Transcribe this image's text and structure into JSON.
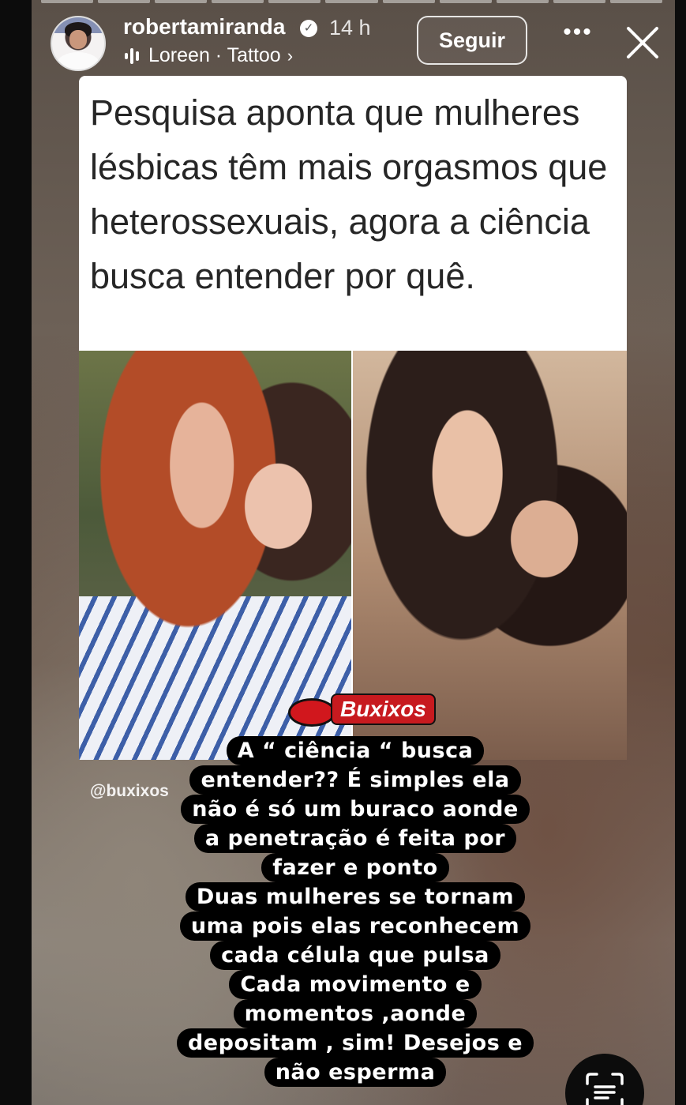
{
  "story": {
    "progress_total": 11,
    "progress_done": 0
  },
  "header": {
    "username": "robertamiranda",
    "verified_icon": "verified-badge-icon",
    "time_ago": "14 h",
    "music": "Loreen · Tattoo",
    "music_chevron": "›",
    "follow_label": "Seguir",
    "more_label": "•••"
  },
  "post": {
    "headline": "Pesquisa aponta que mulheres lésbicas têm mais orgasmos que heterossexuais, agora a ciência busca entender por quê.",
    "logo_text": "Buxixos",
    "watermark": "@buxixos"
  },
  "caption": {
    "lines": [
      "A “ ciência “ busca",
      "entender?? É simples ela",
      "não é só um buraco aonde",
      "a penetração é feita por",
      "fazer e ponto",
      "Duas mulheres se tornam",
      "uma pois elas reconhecem",
      "cada célula que pulsa",
      "Cada movimento e",
      "momentos ,aonde",
      "depositam , sim! Desejos e",
      "não esperma"
    ]
  },
  "colors": {
    "caption_bg": "#000000",
    "caption_text": "#ffffff",
    "card_bg": "#ffffff",
    "headline_text": "#262626",
    "logo_red": "#c71a1f"
  }
}
